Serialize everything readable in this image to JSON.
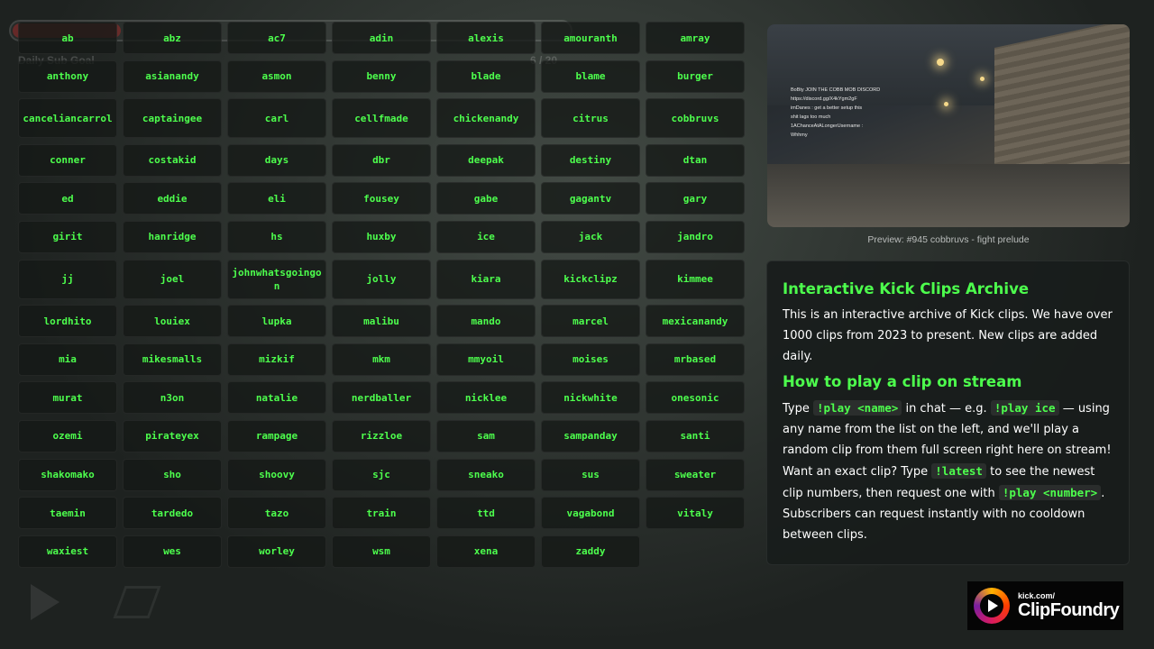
{
  "background": {
    "goal_label": "Daily Sub Goal",
    "goal_count": "6 / 20"
  },
  "names": [
    "ab",
    "abz",
    "ac7",
    "adin",
    "alexis",
    "amouranth",
    "amray",
    "anthony",
    "asianandy",
    "asmon",
    "benny",
    "blade",
    "blame",
    "burger",
    "canceliancarrol",
    "captaingee",
    "carl",
    "cellfmade",
    "chickenandy",
    "citrus",
    "cobbruvs",
    "conner",
    "costakid",
    "days",
    "dbr",
    "deepak",
    "destiny",
    "dtan",
    "ed",
    "eddie",
    "eli",
    "fousey",
    "gabe",
    "gagantv",
    "gary",
    "girit",
    "hanridge",
    "hs",
    "huxby",
    "ice",
    "jack",
    "jandro",
    "jj",
    "joel",
    "johnwhatsgoingon",
    "jolly",
    "kiara",
    "kickclipz",
    "kimmee",
    "lordhito",
    "louiex",
    "lupka",
    "malibu",
    "mando",
    "marcel",
    "mexicanandy",
    "mia",
    "mikesmalls",
    "mizkif",
    "mkm",
    "mmyoil",
    "moises",
    "mrbased",
    "murat",
    "n3on",
    "natalie",
    "nerdballer",
    "nicklee",
    "nickwhite",
    "onesonic",
    "ozemi",
    "pirateyex",
    "rampage",
    "rizzloe",
    "sam",
    "sampanday",
    "santi",
    "shakomako",
    "sho",
    "shoovy",
    "sjc",
    "sneako",
    "sus",
    "sweater",
    "taemin",
    "tardedo",
    "tazo",
    "train",
    "ttd",
    "vagabond",
    "vitaly",
    "waxiest",
    "wes",
    "worley",
    "wsm",
    "xena",
    "zaddy"
  ],
  "preview": {
    "caption": "Preview: #945 cobbruvs - fight prelude",
    "chat_lines": [
      "BoBty JOIN THE COBB MOB DISCORD",
      "https://discord.gg/X4kYgm2gF",
      "imDanes : get a better setup this",
      "shit lags too much",
      "1AChanceAtALongerUsername :",
      "Whhmy"
    ]
  },
  "info": {
    "heading1": "Interactive Kick Clips Archive",
    "intro": "This is an interactive archive of Kick clips. We have over 1000 clips from 2023 to present. New clips are added daily.",
    "heading2": "How to play a clip on stream",
    "type_word": "Type",
    "cmd_play_name": "!play <name>",
    "in_chat": "in chat — e.g.",
    "cmd_play_ice": "!play ice",
    "play_desc": "— using any name from the list on the left, and we'll play a random clip from them full screen right here on stream! Want an exact clip? Type",
    "cmd_latest": "!latest",
    "latest_desc": "to see the newest clip numbers, then request one with",
    "cmd_play_number": "!play <number>",
    "subs_desc": ". Subscribers can request instantly with no cooldown between clips."
  },
  "logo": {
    "small": "kick.com/",
    "big": "ClipFoundry"
  },
  "colors": {
    "accent_green": "#4dff4d",
    "panel_bg": "#181c1b"
  }
}
